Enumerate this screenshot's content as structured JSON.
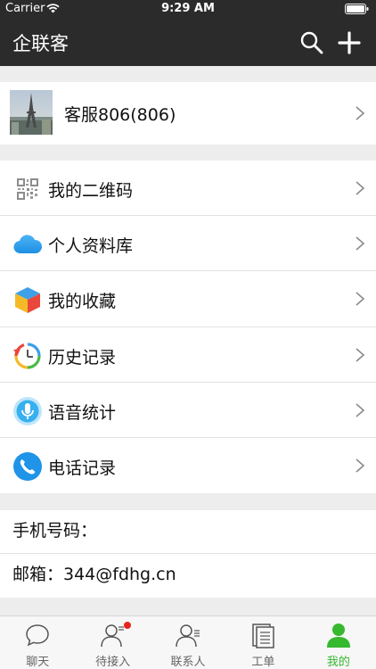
{
  "status_bar": {
    "carrier": "Carrier",
    "time": "9:29 AM"
  },
  "nav": {
    "title": "企联客"
  },
  "profile": {
    "name": "客服806(806)"
  },
  "menu": {
    "items": [
      {
        "label": "我的二维码",
        "icon": "qrcode-icon"
      },
      {
        "label": "个人资料库",
        "icon": "cloud-icon"
      },
      {
        "label": "我的收藏",
        "icon": "cube-icon"
      },
      {
        "label": "历史记录",
        "icon": "history-clock-icon"
      },
      {
        "label": "语音统计",
        "icon": "microphone-icon"
      },
      {
        "label": "电话记录",
        "icon": "phone-icon"
      }
    ]
  },
  "info": {
    "phone_label": "手机号码：",
    "email_label": "邮箱：344@fdhg.cn"
  },
  "tabs": [
    {
      "label": "聊天",
      "icon": "chat-bubble-icon"
    },
    {
      "label": "待接入",
      "icon": "person-pending-icon"
    },
    {
      "label": "联系人",
      "icon": "contacts-icon"
    },
    {
      "label": "工单",
      "icon": "document-icon"
    },
    {
      "label": "我的",
      "icon": "person-icon"
    }
  ],
  "colors": {
    "nav_bg": "#2b2b2b",
    "active_tab": "#36b82f",
    "badge": "#e5261c"
  }
}
